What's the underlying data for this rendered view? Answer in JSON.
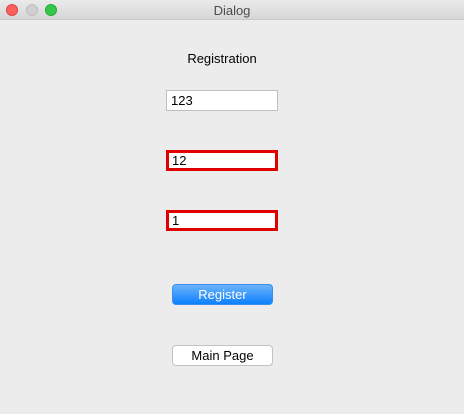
{
  "window": {
    "title": "Dialog"
  },
  "form": {
    "heading": "Registration",
    "fields": [
      {
        "value": "123",
        "state": "normal"
      },
      {
        "value": "12",
        "state": "error"
      },
      {
        "value": "1",
        "state": "error"
      }
    ],
    "register_label": "Register",
    "main_page_label": "Main Page"
  },
  "colors": {
    "error_border": "#e00000",
    "primary_button": "#0d80fc",
    "window_bg": "#ececec"
  }
}
